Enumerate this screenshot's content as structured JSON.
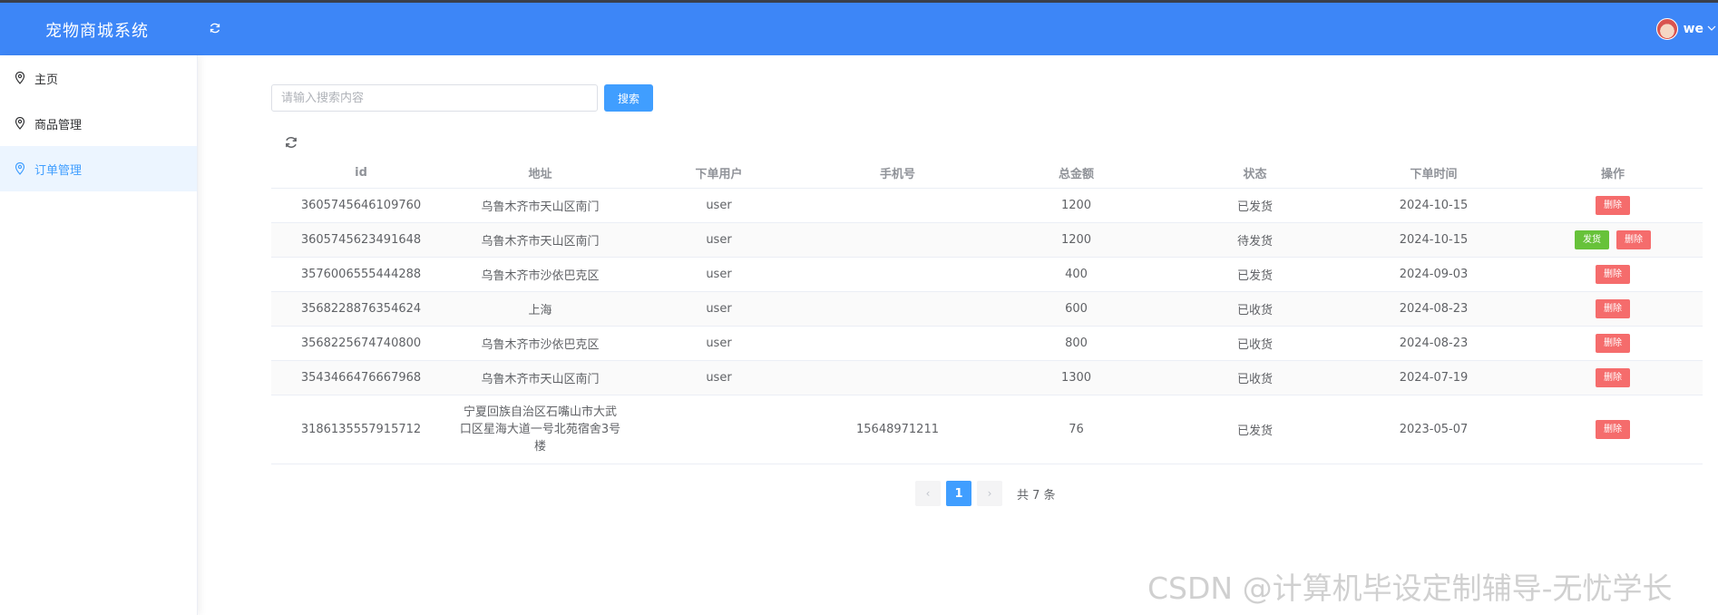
{
  "header": {
    "title": "宠物商城系统",
    "username": "we"
  },
  "sidebar": {
    "items": [
      {
        "label": "主页"
      },
      {
        "label": "商品管理"
      },
      {
        "label": "订单管理"
      }
    ]
  },
  "search": {
    "placeholder": "请输入搜索内容",
    "value": "",
    "button_label": "搜索"
  },
  "table": {
    "columns": [
      "id",
      "地址",
      "下单用户",
      "手机号",
      "总金额",
      "状态",
      "下单时间",
      "操作"
    ],
    "rows": [
      {
        "id": "3605745646109760",
        "address": "乌鲁木齐市天山区南门",
        "user": "user",
        "phone": "",
        "total": "1200",
        "status": "已发货",
        "time": "2024-10-15",
        "actions": [
          "删除"
        ]
      },
      {
        "id": "3605745623491648",
        "address": "乌鲁木齐市天山区南门",
        "user": "user",
        "phone": "",
        "total": "1200",
        "status": "待发货",
        "time": "2024-10-15",
        "actions": [
          "发货",
          "删除"
        ]
      },
      {
        "id": "3576006555444288",
        "address": "乌鲁木齐市沙依巴克区",
        "user": "user",
        "phone": "",
        "total": "400",
        "status": "已发货",
        "time": "2024-09-03",
        "actions": [
          "删除"
        ]
      },
      {
        "id": "3568228876354624",
        "address": "上海",
        "user": "user",
        "phone": "",
        "total": "600",
        "status": "已收货",
        "time": "2024-08-23",
        "actions": [
          "删除"
        ]
      },
      {
        "id": "3568225674740800",
        "address": "乌鲁木齐市沙依巴克区",
        "user": "user",
        "phone": "",
        "total": "800",
        "status": "已收货",
        "time": "2024-08-23",
        "actions": [
          "删除"
        ]
      },
      {
        "id": "3543466476667968",
        "address": "乌鲁木齐市天山区南门",
        "user": "user",
        "phone": "",
        "total": "1300",
        "status": "已收货",
        "time": "2024-07-19",
        "actions": [
          "删除"
        ]
      },
      {
        "id": "3186135557915712",
        "address_lines": [
          "宁夏回族自治区石嘴山市大武",
          "口区星海大道一号北苑宿舍3号",
          "楼"
        ],
        "user": "",
        "phone": "15648971211",
        "total": "76",
        "status": "已发货",
        "time": "2023-05-07",
        "actions": [
          "删除"
        ]
      }
    ]
  },
  "pagination": {
    "prev": "‹",
    "current": "1",
    "next": "›",
    "total_text": "共 7 条"
  },
  "watermark": "CSDN @计算机毕设定制辅导-无忧学长",
  "colors": {
    "header_bg": "#3d86f7",
    "primary": "#409eff",
    "danger": "#f56c6c",
    "success": "#67c23a",
    "active_nav_bg": "#ecf5ff"
  },
  "icons": {
    "nav": "location-pin-icon",
    "refresh": "refresh-icon",
    "caret": "chevron-down-icon"
  }
}
